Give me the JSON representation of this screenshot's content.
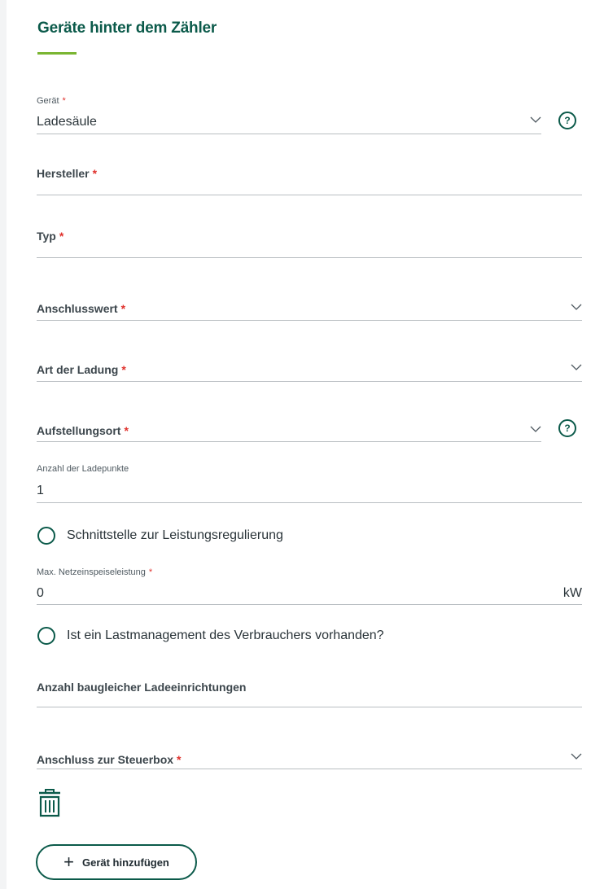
{
  "section": {
    "title": "Geräte hinter dem Zähler"
  },
  "required_mark": "*",
  "fields": {
    "geraet": {
      "label": "Gerät",
      "value": "Ladesäule"
    },
    "hersteller": {
      "label": "Hersteller"
    },
    "typ": {
      "label": "Typ"
    },
    "anschlusswert": {
      "label": "Anschlusswert"
    },
    "art_ladung": {
      "label": "Art der Ladung"
    },
    "aufstellungsort": {
      "label": "Aufstellungsort"
    },
    "ladepunkte": {
      "label": "Anzahl der Ladepunkte",
      "value": "1"
    },
    "netzeinspeise": {
      "label": "Max. Netzeinspeiseleistung",
      "value": "0",
      "unit": "kW"
    },
    "baugleiche": {
      "label": "Anzahl baugleicher Ladeeinrichtungen"
    },
    "steuerbox": {
      "label": "Anschluss zur Steuerbox"
    }
  },
  "options": {
    "schnittstelle": "Schnittstelle zur Leistungsregulierung",
    "lastmanagement": "Ist ein Lastmanagement des Verbrauchers vorhanden?"
  },
  "icons": {
    "help": "?",
    "help_name": "help-icon",
    "chevron": "chevron-down-icon",
    "trash": "trash-icon",
    "plus": "plus-icon"
  },
  "actions": {
    "add_device_label": "Gerät hinzufügen",
    "plus_glyph": "+"
  },
  "colors": {
    "brand": "#0b5a4a",
    "accent": "#7ab532",
    "required": "#e0312c"
  }
}
